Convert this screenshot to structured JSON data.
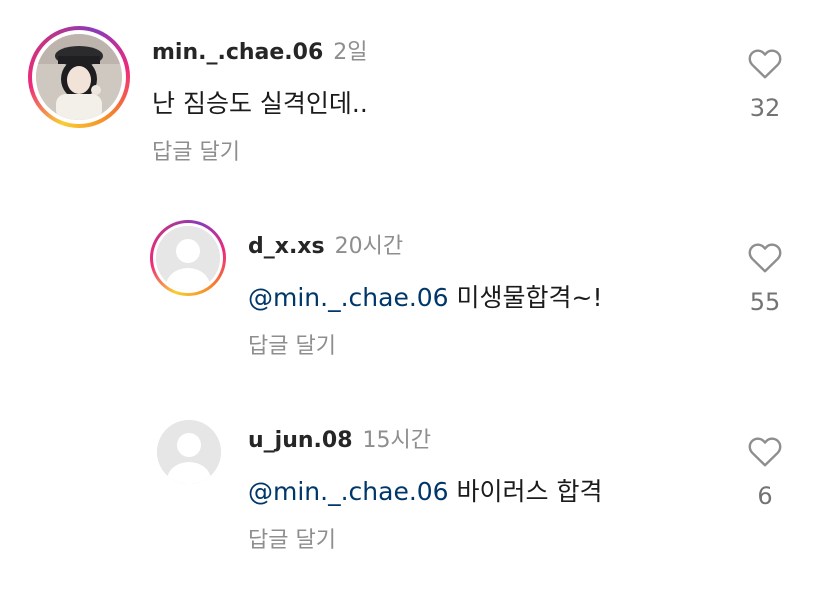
{
  "comments": [
    {
      "username": "min._.chae.06",
      "time": "2일",
      "mention": "",
      "text": "난 짐승도 실격인데..",
      "reply_label": "답글 달기",
      "likes": "32",
      "avatar": "photo-avatar",
      "story_ring": true
    },
    {
      "username": "d_x.xs",
      "time": "20시간",
      "mention": "@min._.chae.06",
      "text": "미생물합격~!",
      "reply_label": "답글 달기",
      "likes": "55",
      "avatar": "default-avatar",
      "story_ring": true
    },
    {
      "username": "u_jun.08",
      "time": "15시간",
      "mention": "@min._.chae.06",
      "text": "바이러스 합격",
      "reply_label": "답글 달기",
      "likes": "6",
      "avatar": "default-avatar",
      "story_ring": false
    }
  ],
  "icons": {
    "like": "heart-outline-icon"
  },
  "colors": {
    "mention": "#00376b",
    "secondary_text": "#8e8e8e",
    "primary_text": "#262626"
  }
}
